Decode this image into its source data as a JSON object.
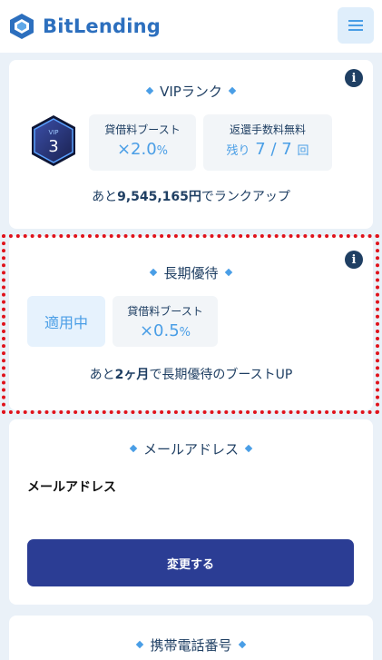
{
  "header": {
    "logo_text": "BitLending",
    "menu_icon": "hamburger-icon"
  },
  "vip": {
    "title": "VIPランク",
    "badge_label": "VIP",
    "badge_level": "3",
    "boost_label": "貸借料ブースト",
    "boost_value": "×2.0",
    "boost_unit": "%",
    "fee_label": "返還手数料無料",
    "fee_prefix": "残り",
    "fee_value": "7 / 7",
    "fee_suffix": "回",
    "remaining_prefix": "あと",
    "remaining_amount": "9,545,165円",
    "remaining_suffix": "でランクアップ"
  },
  "long_term": {
    "title": "長期優待",
    "status": "適用中",
    "boost_label": "貸借料ブースト",
    "boost_value": "×0.5",
    "boost_unit": "%",
    "remaining_prefix": "あと",
    "remaining_amount": "2ヶ月",
    "remaining_suffix": "で長期優待のブーストUP"
  },
  "email": {
    "title": "メールアドレス",
    "field_label": "メールアドレス",
    "change_button": "変更する"
  },
  "phone": {
    "title": "携帯電話番号"
  },
  "colors": {
    "accent": "#4a9ee6",
    "navy": "#1f3f63",
    "button": "#2b3d94",
    "highlight_border": "#e0121b"
  }
}
